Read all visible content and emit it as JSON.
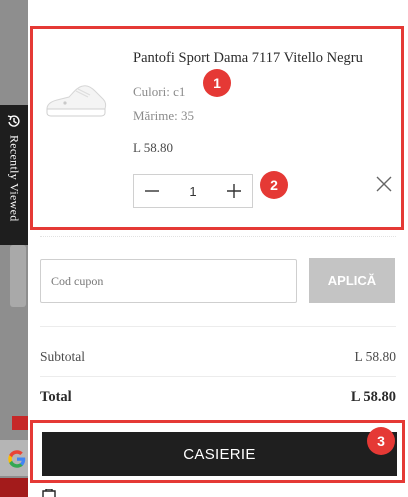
{
  "recently_viewed": {
    "label": "Recently Viewed"
  },
  "cart_item": {
    "name": "Pantofi Sport Dama 7117 Vitello Negru",
    "color": "Culori: c1",
    "size": "Mărime: 35",
    "price": "L 58.80",
    "quantity": "1"
  },
  "coupon": {
    "placeholder": "Cod cupon",
    "apply_label": "APLICĂ"
  },
  "summary": {
    "subtotal_label": "Subtotal",
    "subtotal_value": "L 58.80",
    "total_label": "Total",
    "total_value": "L 58.80"
  },
  "checkout": {
    "label": "CASIERIE"
  },
  "annotations": [
    "1",
    "2",
    "3"
  ],
  "colors": {
    "annotation": "#e53935",
    "checkout_bg": "#1f1f1f",
    "apply_bg": "#c4c4c4"
  },
  "icons": [
    "sneaker-product-image",
    "minus-icon",
    "plus-icon",
    "close-icon",
    "recently-viewed-icon",
    "google-icon"
  ]
}
